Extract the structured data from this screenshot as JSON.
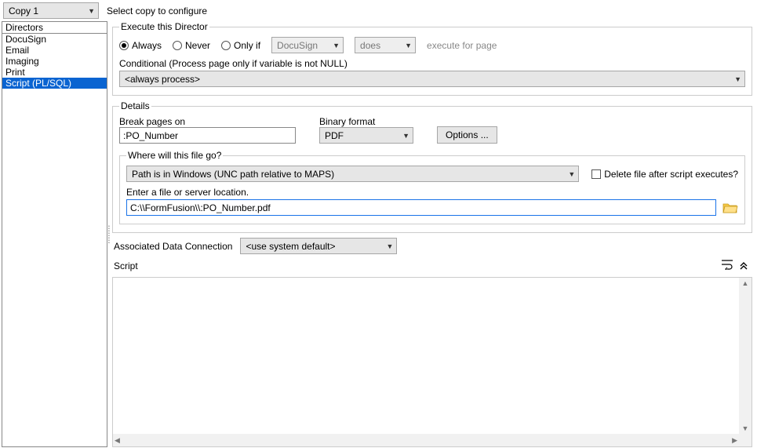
{
  "top": {
    "copy_dropdown": "Copy 1",
    "prompt": "Select copy to configure"
  },
  "directors": {
    "label": "Directors",
    "items": [
      "DocuSign",
      "Email",
      "Imaging",
      "Print",
      "Script (PL/SQL)"
    ],
    "selected_index": 4
  },
  "execute": {
    "legend": "Execute this Director",
    "options": {
      "always": "Always",
      "never": "Never",
      "onlyif": "Only if"
    },
    "selected": "always",
    "var_dropdown": "DocuSign",
    "cond_dropdown": "does",
    "hint": "execute for page",
    "conditional_label": "Conditional (Process page only if variable is not NULL)",
    "conditional_value": "<always process>"
  },
  "details": {
    "legend": "Details",
    "break_pages_label": "Break pages on",
    "break_pages_value": ":PO_Number",
    "binary_format_label": "Binary format",
    "binary_format_value": "PDF",
    "options_button": "Options ...",
    "filego": {
      "legend": "Where will this file go?",
      "path_value": "Path is in Windows (UNC path relative to MAPS)",
      "delete_checkbox": "Delete file after script executes?",
      "delete_checked": false,
      "enter_label": "Enter a file or server location.",
      "location_value": "C:\\\\FormFusion\\\\:PO_Number.pdf"
    }
  },
  "assoc": {
    "label": "Associated Data Connection",
    "value": "<use system default>"
  },
  "script": {
    "label": "Script",
    "content": ""
  }
}
